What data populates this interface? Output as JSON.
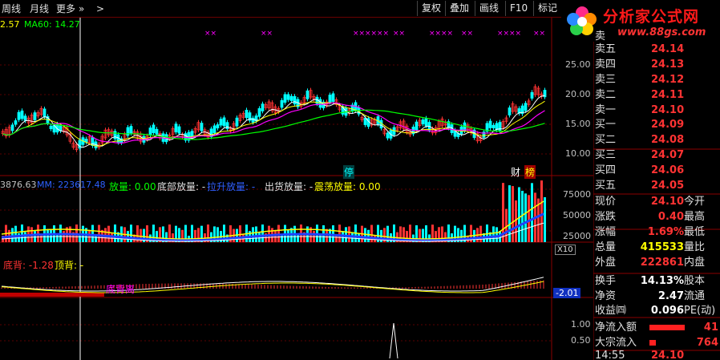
{
  "toolbar": {
    "weekly": "周线",
    "monthly": "月线",
    "more": "更多",
    "more_chevron": "»",
    "next_arrow": ">",
    "restore_rights": "复权",
    "overlay": "叠加",
    "draw_line": "画线",
    "f10": "F10",
    "mark": "标记"
  },
  "logo": {
    "title": "分析家公式网",
    "url": "www.88gs.com"
  },
  "price_panel": {
    "ma_first": "2.57",
    "ma60_label": "MA60: 14.27",
    "y_ticks": [
      "25.00",
      "20.00",
      "15.00",
      "10.00"
    ],
    "marker_stop": "停",
    "marker_finance": "财",
    "marker_list": "榜",
    "top_marker": "××"
  },
  "volume_panel": {
    "header_value": "3876.63",
    "mm_label": "MM: 223617.48",
    "fangliang": "放量: 0.00",
    "bottom_fangliang": "底部放量: -",
    "rise_fangliang": "拉升放量: -",
    "ship_fangliang": "出货放量: -",
    "shock_fangliang": "震荡放量: 0.00",
    "y_ticks": [
      "75000",
      "50000",
      "25000"
    ],
    "unit": "X10"
  },
  "macd_panel": {
    "bottom_div": "底背: -1.28",
    "top_div": "顶背: -",
    "annotation": "底背离",
    "value_box": "-2.01"
  },
  "flag_panel": {
    "y_ticks": [
      "1.00",
      "0.50"
    ]
  },
  "order_book": {
    "asks": [
      {
        "label": "卖五",
        "price": "24.14"
      },
      {
        "label": "卖四",
        "price": "24.13"
      },
      {
        "label": "卖三",
        "price": "24.12"
      },
      {
        "label": "卖二",
        "price": "24.11"
      },
      {
        "label": "卖一",
        "price": "24.10"
      }
    ],
    "bids": [
      {
        "label": "买一",
        "price": "24.09"
      },
      {
        "label": "买二",
        "price": "24.08"
      },
      {
        "label": "买三",
        "price": "24.07"
      },
      {
        "label": "买四",
        "price": "24.06"
      },
      {
        "label": "买五",
        "price": "24.05"
      }
    ],
    "partial_top": "卖"
  },
  "stats": [
    {
      "k1": "现价",
      "v1": "24.10",
      "k2": "今开",
      "color": "red"
    },
    {
      "k1": "涨跌",
      "v1": "0.40",
      "k2": "最高",
      "color": "red"
    },
    {
      "k1": "涨幅",
      "v1": "1.69%",
      "k2": "最低",
      "color": "red"
    },
    {
      "k1": "总量",
      "v1": "415533",
      "k2": "量比",
      "color": "yel"
    },
    {
      "k1": "外盘",
      "v1": "222861",
      "k2": "内盘",
      "color": "red"
    },
    {
      "k1": "换手",
      "v1": "14.13%",
      "k2": "股本",
      "color": "wht"
    },
    {
      "k1": "净资",
      "v1": "2.47",
      "k2": "流通",
      "color": "wht"
    },
    {
      "k1": "收益㈣",
      "v1": "0.096",
      "k2": "PE(动)",
      "color": "wht"
    }
  ],
  "flows": [
    {
      "label": "净流入额",
      "value": "41"
    },
    {
      "label": "大宗流入",
      "value": "764"
    }
  ],
  "footer": {
    "time": "14:55",
    "price": "24.10"
  },
  "colors": {
    "up": "#ff3333",
    "down": "#00ffff",
    "ma5": "#ffffff",
    "ma10": "#ffff00",
    "ma20": "#ff00ff",
    "ma60": "#00ff00",
    "grid": "#8b0000"
  }
}
